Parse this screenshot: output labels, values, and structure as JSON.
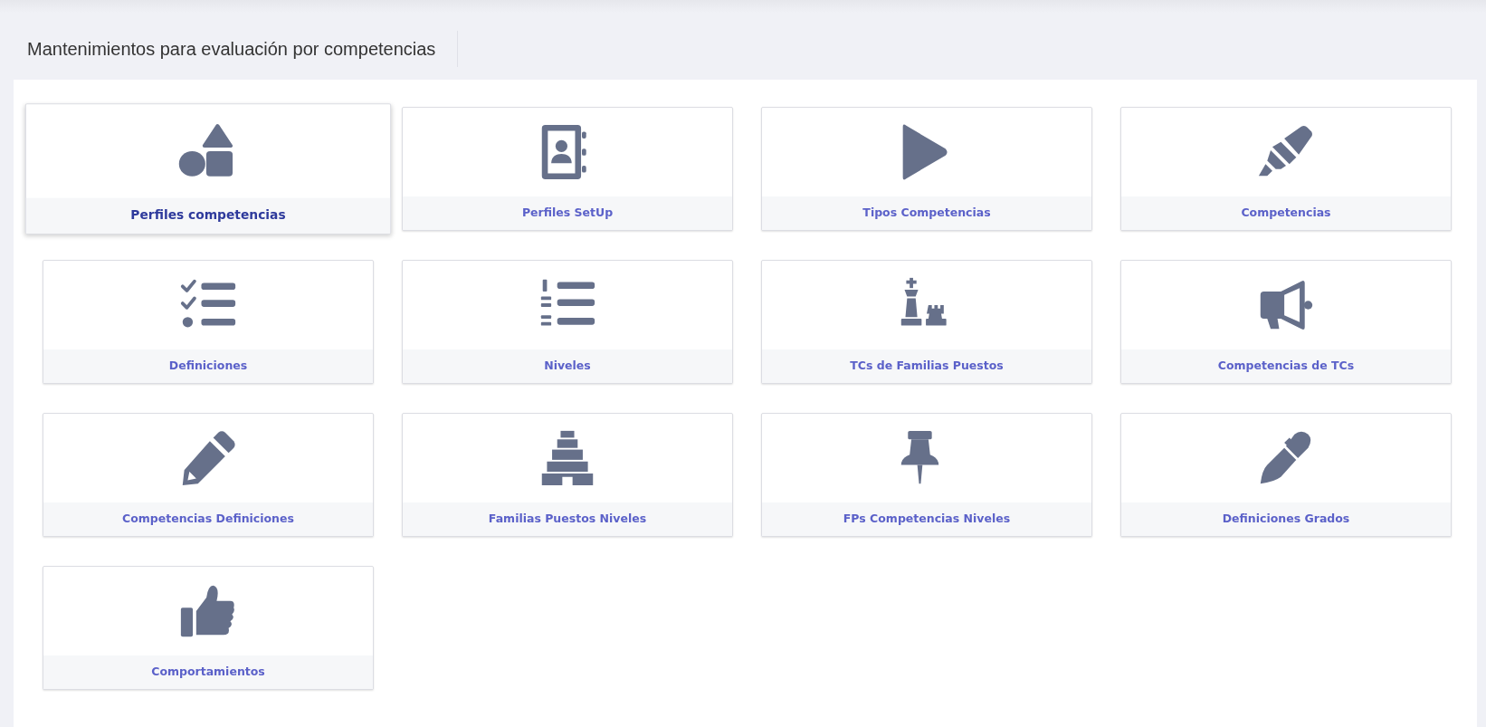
{
  "page": {
    "title": "Mantenimientos para evaluación por competencias"
  },
  "tiles": [
    {
      "label": "Perfiles competencias",
      "selected": true
    },
    {
      "label": "Perfiles SetUp",
      "selected": false
    },
    {
      "label": "Tipos Competencias",
      "selected": false
    },
    {
      "label": "Competencias",
      "selected": false
    },
    {
      "label": "Definiciones",
      "selected": false
    },
    {
      "label": "Niveles",
      "selected": false
    },
    {
      "label": "TCs de Familias Puestos",
      "selected": false
    },
    {
      "label": "Competencias de TCs",
      "selected": false
    },
    {
      "label": "Competencias Definiciones",
      "selected": false
    },
    {
      "label": "Familias Puestos Niveles",
      "selected": false
    },
    {
      "label": "FPs Competencias Niveles",
      "selected": false
    },
    {
      "label": "Definiciones Grados",
      "selected": false
    },
    {
      "label": "Comportamientos",
      "selected": false
    }
  ]
}
